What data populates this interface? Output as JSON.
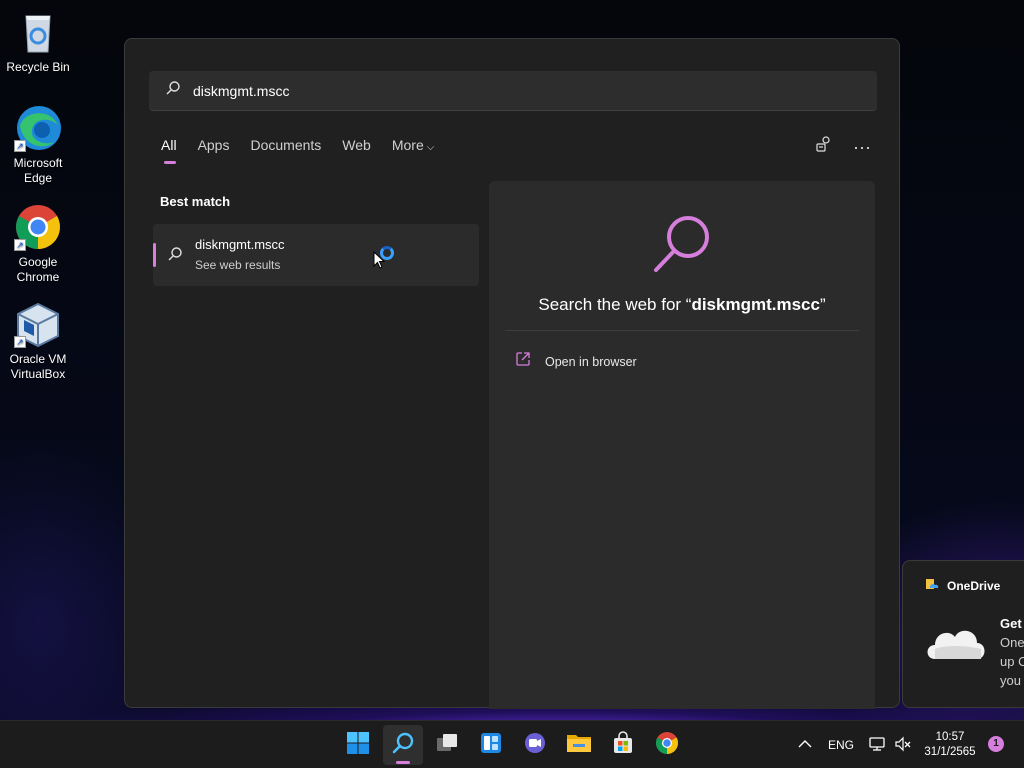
{
  "desktop": {
    "icons": [
      {
        "label_lines": [
          "Recycle Bin"
        ],
        "icon": "recycle-bin-icon"
      },
      {
        "label_lines": [
          "Microsoft",
          "Edge"
        ],
        "icon": "edge-icon"
      },
      {
        "label_lines": [
          "Google",
          "Chrome"
        ],
        "icon": "chrome-icon"
      },
      {
        "label_lines": [
          "Oracle VM",
          "VirtualBox"
        ],
        "icon": "virtualbox-icon"
      }
    ]
  },
  "search": {
    "query": "diskmgmt.mscc",
    "tabs": [
      "All",
      "Apps",
      "Documents",
      "Web",
      "More"
    ],
    "active_tab": "All",
    "best_match_label": "Best match",
    "result": {
      "title": "diskmgmt.mscc",
      "subtitle": "See web results"
    },
    "preview": {
      "title_prefix": "Search the web for “",
      "title_query": "diskmgmt.mscc",
      "title_suffix": "”",
      "open_in_browser": "Open in browser"
    }
  },
  "toast": {
    "app_name": "OneDrive",
    "line1": "Get",
    "line2": "One",
    "line3": "up O",
    "line4": "you"
  },
  "taskbar": {
    "apps": [
      "start-icon",
      "search-icon",
      "task-view-icon",
      "widgets-icon",
      "chat-icon",
      "file-explorer-icon",
      "store-icon",
      "chrome-icon"
    ],
    "active_app": "search-icon",
    "language": "ENG",
    "time": "10:57",
    "date": "31/1/2565",
    "notification_count": "1"
  },
  "colors": {
    "accent": "#d57edc",
    "panel_bg": "#202020",
    "card_bg": "#2b2b2b",
    "taskbar_bg": "#1c1c1c"
  }
}
